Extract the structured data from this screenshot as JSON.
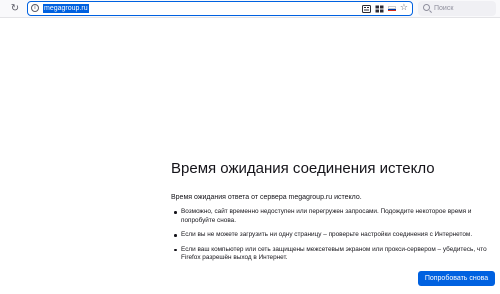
{
  "browser": {
    "url": "megagroup.ru",
    "search_placeholder": "Поиск",
    "icons": [
      "reload-icon",
      "info-icon",
      "reader-view-icon",
      "translate-icon",
      "ru-flag-icon",
      "bookmark-star-icon",
      "search-icon"
    ],
    "accent_color": "#0061e0"
  },
  "error": {
    "title": "Время ожидания соединения истекло",
    "description": "Время ожидания ответа от сервера megagroup.ru истекло.",
    "suggestions": [
      "Возможно, сайт временно недоступен или перегружен запросами. Подождите некоторое время и попробуйте снова.",
      "Если вы не можете загрузить ни одну страницу – проверьте настройки соединения с Интернетом.",
      "Если ваш компьютер или сеть защищены межсетевым экраном или прокси-сервером – убедитесь, что Firefox разрешён выход в Интернет."
    ],
    "retry_label": "Попробовать снова"
  }
}
